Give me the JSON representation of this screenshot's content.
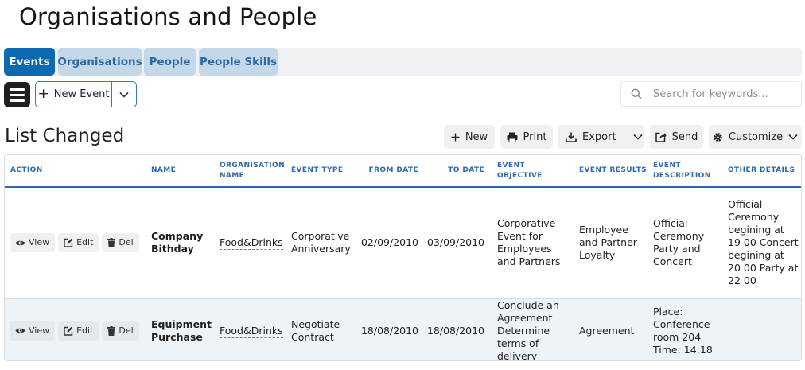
{
  "page": {
    "title": "Organisations and People"
  },
  "tabs": [
    {
      "label": "Events",
      "active": true
    },
    {
      "label": "Organisations",
      "active": false
    },
    {
      "label": "People",
      "active": false
    },
    {
      "label": "People Skills",
      "active": false
    }
  ],
  "toolbar": {
    "new_event_label": "New Event",
    "search_placeholder": "Search for keywords..."
  },
  "list": {
    "title": "List Changed",
    "buttons": {
      "new": "New",
      "print": "Print",
      "export": "Export",
      "send": "Send",
      "customize": "Customize"
    }
  },
  "table": {
    "columns": {
      "action": "Action",
      "name": "Name",
      "organisation_name": "Organisation Name",
      "event_type": "Event Type",
      "from_date": "From Date",
      "to_date": "To Date",
      "event_objective": "Event Objective",
      "event_results": "Event Results",
      "event_description": "Event Description",
      "other_details": "Other Details"
    },
    "actions": {
      "view": "View",
      "edit": "Edit",
      "del": "Del"
    },
    "rows": [
      {
        "name": "Company Bithday",
        "organisation": "Food&Drinks",
        "event_type": "Corporative Anniversary",
        "from_date": "02/09/2010",
        "to_date": "03/09/2010",
        "objective": "Corporative Event for Employees and Partners",
        "results": "Employee and Partner Loyalty",
        "description": "Official Ceremony Party and Concert",
        "other_details": "Official Ceremony begining at 19 00 Concert begining at 20 00 Party at 22 00"
      },
      {
        "name": "Equipment Purchase",
        "organisation": "Food&Drinks",
        "event_type": "Negotiate Contract",
        "from_date": "18/08/2010",
        "to_date": "18/08/2010",
        "objective": "Conclude an Agreement Determine terms of delivery",
        "results": "Agreement",
        "description": "Place: Conference room 204 Time: 14:18",
        "other_details": ""
      }
    ]
  },
  "colors": {
    "primary": "#0d6ab1",
    "tab_inactive_bg": "#c4d8ea",
    "header_text": "#2a6aa6",
    "row_alt_bg": "#eef3f8"
  }
}
